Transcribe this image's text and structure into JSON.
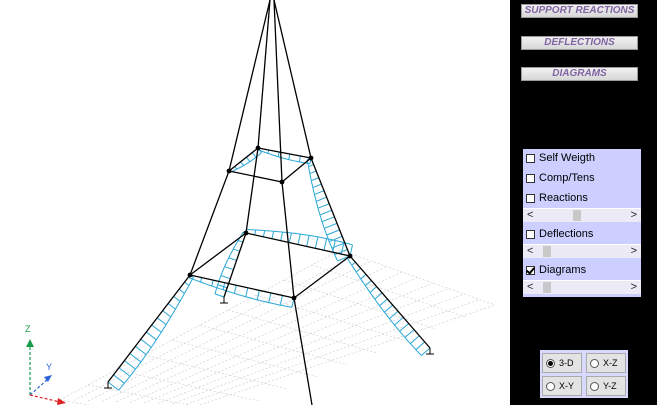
{
  "buttons": {
    "support_reactions": "SUPPORT REACTIONS",
    "deflections": "DEFLECTIONS",
    "diagrams": "DIAGRAMS"
  },
  "options": {
    "self_weight": {
      "label": "Self Weigth",
      "checked": false
    },
    "comp_tens": {
      "label": "Comp/Tens",
      "checked": false
    },
    "reactions": {
      "label": "Reactions",
      "checked": false
    },
    "deflections": {
      "label": "Deflections",
      "checked": false
    },
    "diagrams": {
      "label": "Diagrams",
      "checked": true
    }
  },
  "scroll_arrows": {
    "left": "<",
    "right": ">"
  },
  "views": {
    "three_d": {
      "label": "3-D",
      "selected": true
    },
    "xz": {
      "label": "X-Z",
      "selected": false
    },
    "xy": {
      "label": "X-Y",
      "selected": false
    },
    "yz": {
      "label": "Y-Z",
      "selected": false
    }
  },
  "axes": {
    "z": "Z",
    "y": "Y",
    "z_color": "#1a9a4a",
    "y_color": "#2b64d8",
    "x_color": "#e02020"
  },
  "colors": {
    "panel_bg": "#000000",
    "button_text": "#8064a2",
    "option_bg": "#cccfff",
    "structure": "#000000",
    "diagram": "#2aa7d6",
    "grid": "#c8c8c8"
  }
}
